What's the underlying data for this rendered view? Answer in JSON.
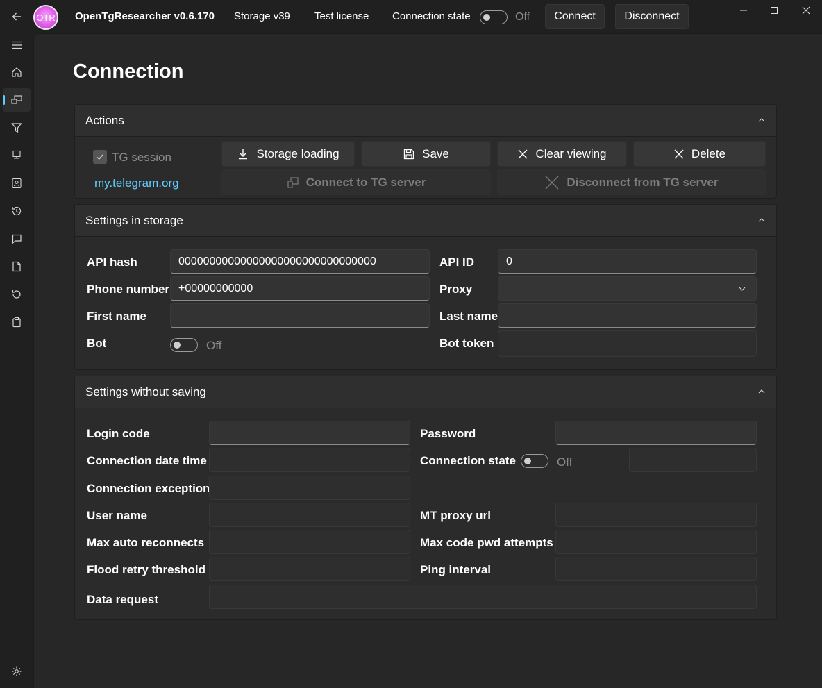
{
  "titlebar": {
    "logo_text": "OTR",
    "app_title": "OpenTgResearcher v0.6.170",
    "storage": "Storage v39",
    "license": "Test license",
    "connection_state_label": "Connection state",
    "connection_state_value": "Off",
    "connect_label": "Connect",
    "disconnect_label": "Disconnect"
  },
  "sidebar": {
    "items": [
      "menu-icon",
      "home-icon",
      "connection-icon",
      "filter-icon",
      "client-icon",
      "contacts-icon",
      "history-icon",
      "chat-icon",
      "document-icon",
      "refresh-icon",
      "clipboard-icon",
      "settings-icon"
    ],
    "active": "connection-icon",
    "accent_color": "#60cdff"
  },
  "page": {
    "title": "Connection"
  },
  "actions": {
    "header": "Actions",
    "tg_session_label": "TG session",
    "tg_session_checked": true,
    "link_text": "my.telegram.org",
    "buttons": {
      "storage_loading": "Storage loading",
      "save": "Save",
      "clear_viewing": "Clear viewing",
      "delete": "Delete",
      "connect_tg": "Connect to TG server",
      "disconnect_tg": "Disconnect from TG server"
    }
  },
  "storage_settings": {
    "header": "Settings in storage",
    "api_hash_label": "API hash",
    "api_hash_value": "00000000000000000000000000000000",
    "api_id_label": "API ID",
    "api_id_value": "0",
    "phone_label": "Phone number",
    "phone_value": "+00000000000",
    "proxy_label": "Proxy",
    "proxy_value": "",
    "first_name_label": "First name",
    "first_name_value": "",
    "last_name_label": "Last name",
    "last_name_value": "",
    "bot_label": "Bot",
    "bot_state": "Off",
    "bot_token_label": "Bot token",
    "bot_token_value": ""
  },
  "nosave_settings": {
    "header": "Settings without saving",
    "login_code_label": "Login code",
    "password_label": "Password",
    "conn_datetime_label": "Connection date time",
    "conn_state_label": "Connection state",
    "conn_state_value": "Off",
    "conn_exception_label": "Connection exception",
    "user_name_label": "User name",
    "mt_proxy_label": "MT proxy url",
    "max_reconnects_label": "Max auto reconnects",
    "max_code_pwd_label": "Max code pwd attempts",
    "flood_retry_label": "Flood retry threshold",
    "ping_interval_label": "Ping interval",
    "data_request_label": "Data request"
  }
}
